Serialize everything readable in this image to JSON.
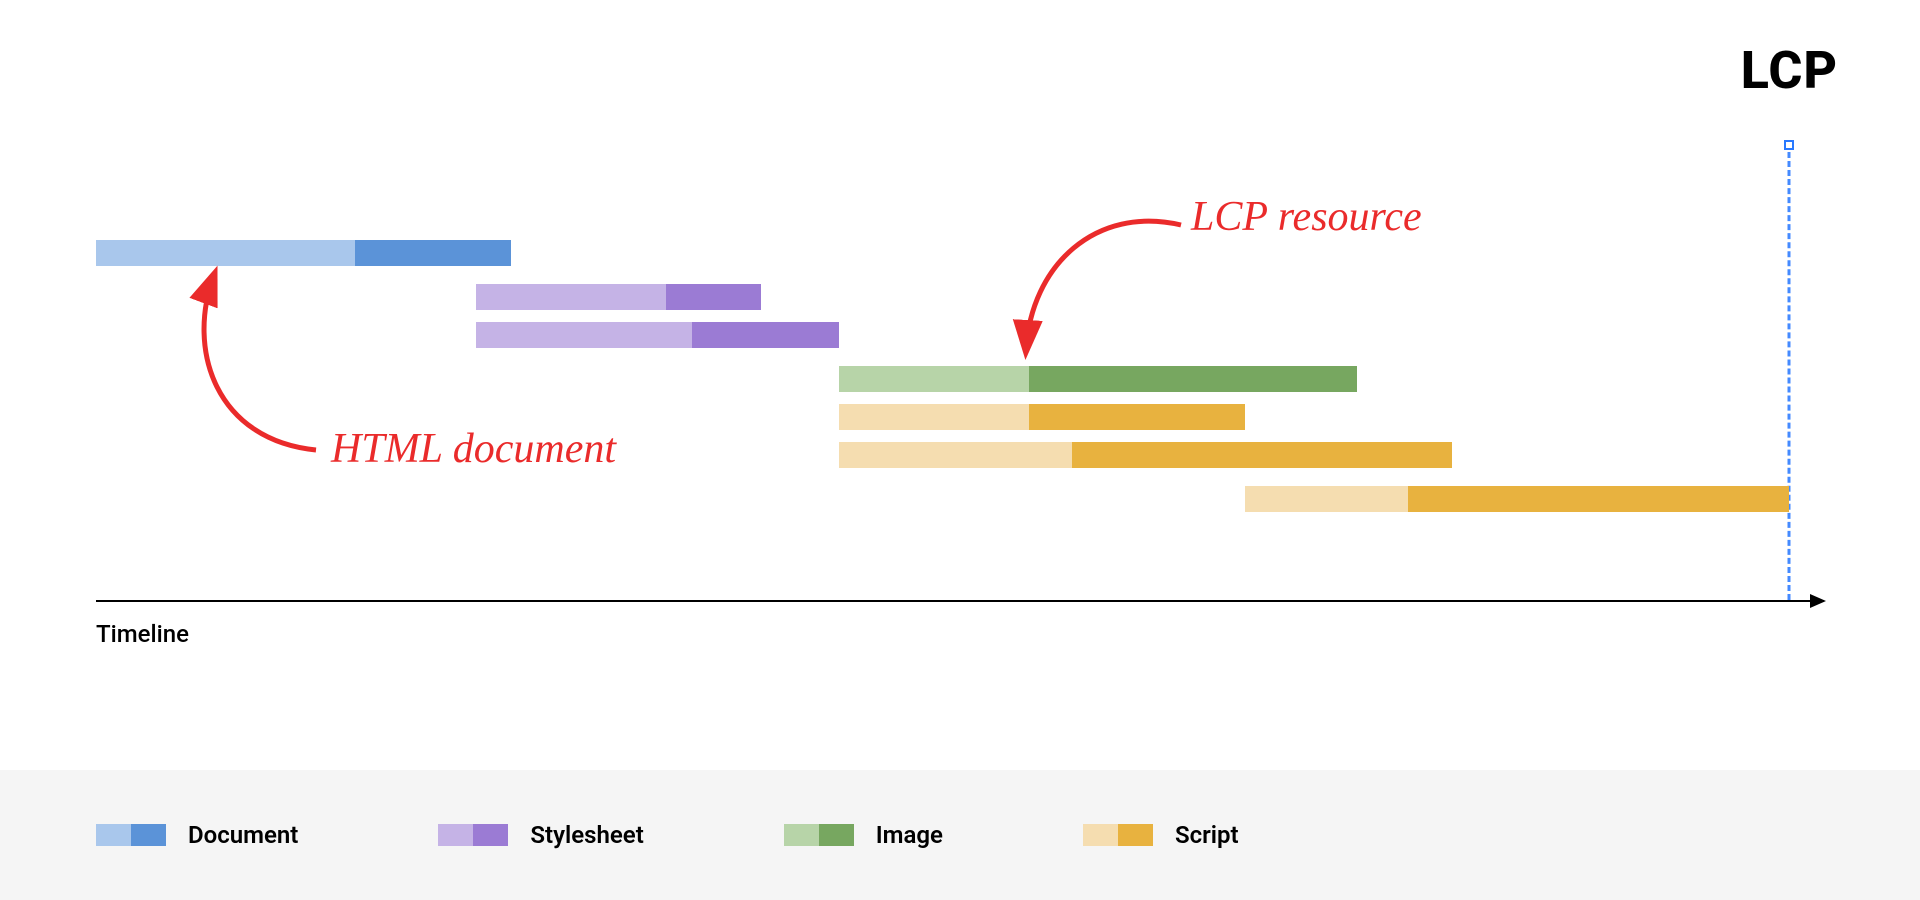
{
  "chart_data": {
    "type": "gantt-timeline",
    "title": "",
    "xlabel": "Timeline",
    "xlim": [
      0,
      100
    ],
    "lcp_position": 98,
    "lcp_label": "LCP",
    "resources": [
      {
        "type": "Document",
        "row": 0,
        "start": 0,
        "split": 15,
        "end": 24,
        "color_light": "#a9c7ec",
        "color_dark": "#5b93d8"
      },
      {
        "type": "Stylesheet",
        "row": 1,
        "start": 22,
        "split": 33,
        "end": 38.5,
        "color_light": "#c5b3e6",
        "color_dark": "#9b7bd4"
      },
      {
        "type": "Stylesheet",
        "row": 2,
        "start": 22,
        "split": 34.5,
        "end": 43,
        "color_light": "#c5b3e6",
        "color_dark": "#9b7bd4"
      },
      {
        "type": "Image",
        "row": 3,
        "start": 43,
        "split": 54,
        "end": 73,
        "color_light": "#b7d4a8",
        "color_dark": "#77a760"
      },
      {
        "type": "Script",
        "row": 4,
        "start": 43,
        "split": 54,
        "end": 66.5,
        "color_light": "#f5ddb0",
        "color_dark": "#e8b23f"
      },
      {
        "type": "Script",
        "row": 5,
        "start": 43,
        "split": 56.5,
        "end": 78.5,
        "color_light": "#f5ddb0",
        "color_dark": "#e8b23f"
      },
      {
        "type": "Script",
        "row": 6,
        "start": 66.5,
        "split": 76,
        "end": 98,
        "color_light": "#f5ddb0",
        "color_dark": "#e8b23f"
      }
    ],
    "annotations": [
      {
        "text": "HTML document",
        "target_row": 0
      },
      {
        "text": "LCP resource",
        "target_row": 3
      }
    ],
    "legend": [
      {
        "label": "Document",
        "color_light": "#a9c7ec",
        "color_dark": "#5b93d8"
      },
      {
        "label": "Stylesheet",
        "color_light": "#c5b3e6",
        "color_dark": "#9b7bd4"
      },
      {
        "label": "Image",
        "color_light": "#b7d4a8",
        "color_dark": "#77a760"
      },
      {
        "label": "Script",
        "color_light": "#f5ddb0",
        "color_dark": "#e8b23f"
      }
    ]
  }
}
